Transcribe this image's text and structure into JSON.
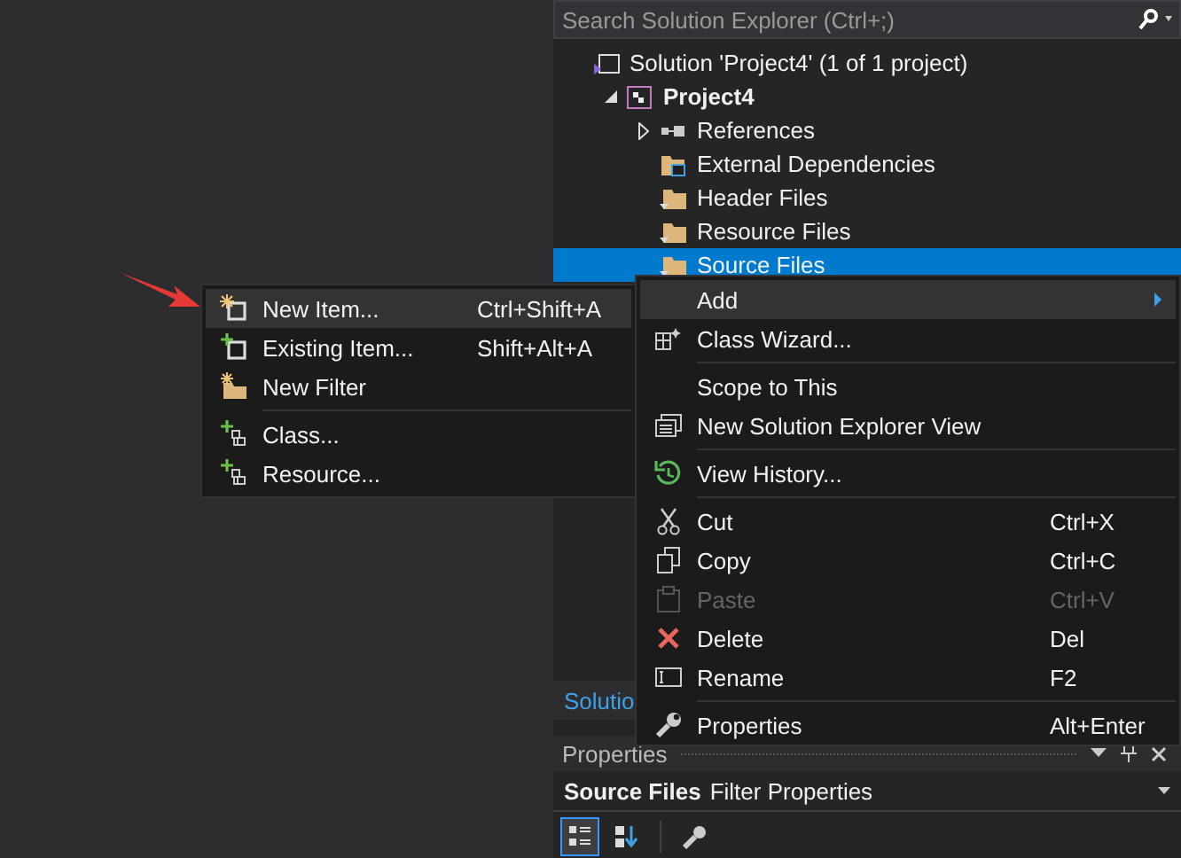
{
  "search": {
    "placeholder": "Search Solution Explorer (Ctrl+;)"
  },
  "tree": [
    {
      "label": "Solution 'Project4' (1 of 1 project)",
      "kind": "solution",
      "selected": false,
      "children": [
        {
          "label": "Project4",
          "kind": "project",
          "selected": false,
          "expanded": true,
          "children": [
            {
              "label": "References",
              "kind": "references",
              "selected": false,
              "expanded": false
            },
            {
              "label": "External Dependencies",
              "kind": "external",
              "selected": false
            },
            {
              "label": "Header Files",
              "kind": "filter",
              "selected": false
            },
            {
              "label": "Resource Files",
              "kind": "filter",
              "selected": false
            },
            {
              "label": "Source Files",
              "kind": "filter",
              "selected": true
            }
          ]
        }
      ]
    }
  ],
  "explorer_tab": "Solutio",
  "context_menu": [
    [
      {
        "label": "Add",
        "highlighted": true,
        "submenu": true,
        "disabled": false
      },
      {
        "label": "Class Wizard...",
        "highlighted": false,
        "submenu": false,
        "disabled": false
      }
    ],
    [
      {
        "label": "Scope to This",
        "highlighted": false,
        "submenu": false,
        "disabled": false
      },
      {
        "label": "New Solution Explorer View",
        "highlighted": false,
        "submenu": false,
        "disabled": false
      }
    ],
    [
      {
        "label": "View History...",
        "highlighted": false,
        "submenu": false,
        "disabled": false
      }
    ],
    [
      {
        "label": "Cut",
        "shortcut": "Ctrl+X",
        "highlighted": false,
        "submenu": false,
        "disabled": false
      },
      {
        "label": "Copy",
        "shortcut": "Ctrl+C",
        "highlighted": false,
        "submenu": false,
        "disabled": false
      },
      {
        "label": "Paste",
        "shortcut": "Ctrl+V",
        "highlighted": false,
        "submenu": false,
        "disabled": true
      },
      {
        "label": "Delete",
        "shortcut": "Del",
        "highlighted": false,
        "submenu": false,
        "disabled": false
      },
      {
        "label": "Rename",
        "shortcut": "F2",
        "highlighted": false,
        "submenu": false,
        "disabled": false
      }
    ],
    [
      {
        "label": "Properties",
        "shortcut": "Alt+Enter",
        "highlighted": false,
        "submenu": false,
        "disabled": false
      }
    ]
  ],
  "submenu": [
    [
      {
        "label": "New Item...",
        "shortcut": "Ctrl+Shift+A",
        "highlighted": true
      },
      {
        "label": "Existing Item...",
        "shortcut": "Shift+Alt+A",
        "highlighted": false
      },
      {
        "label": "New Filter",
        "highlighted": false
      }
    ],
    [
      {
        "label": "Class...",
        "highlighted": false
      },
      {
        "label": "Resource...",
        "highlighted": false
      }
    ]
  ],
  "properties": {
    "title": "Properties",
    "object_name": "Source Files",
    "object_type": "Filter Properties",
    "toolbar": [
      {
        "selected": true
      },
      {
        "selected": false
      },
      {
        "selected": false
      }
    ]
  }
}
